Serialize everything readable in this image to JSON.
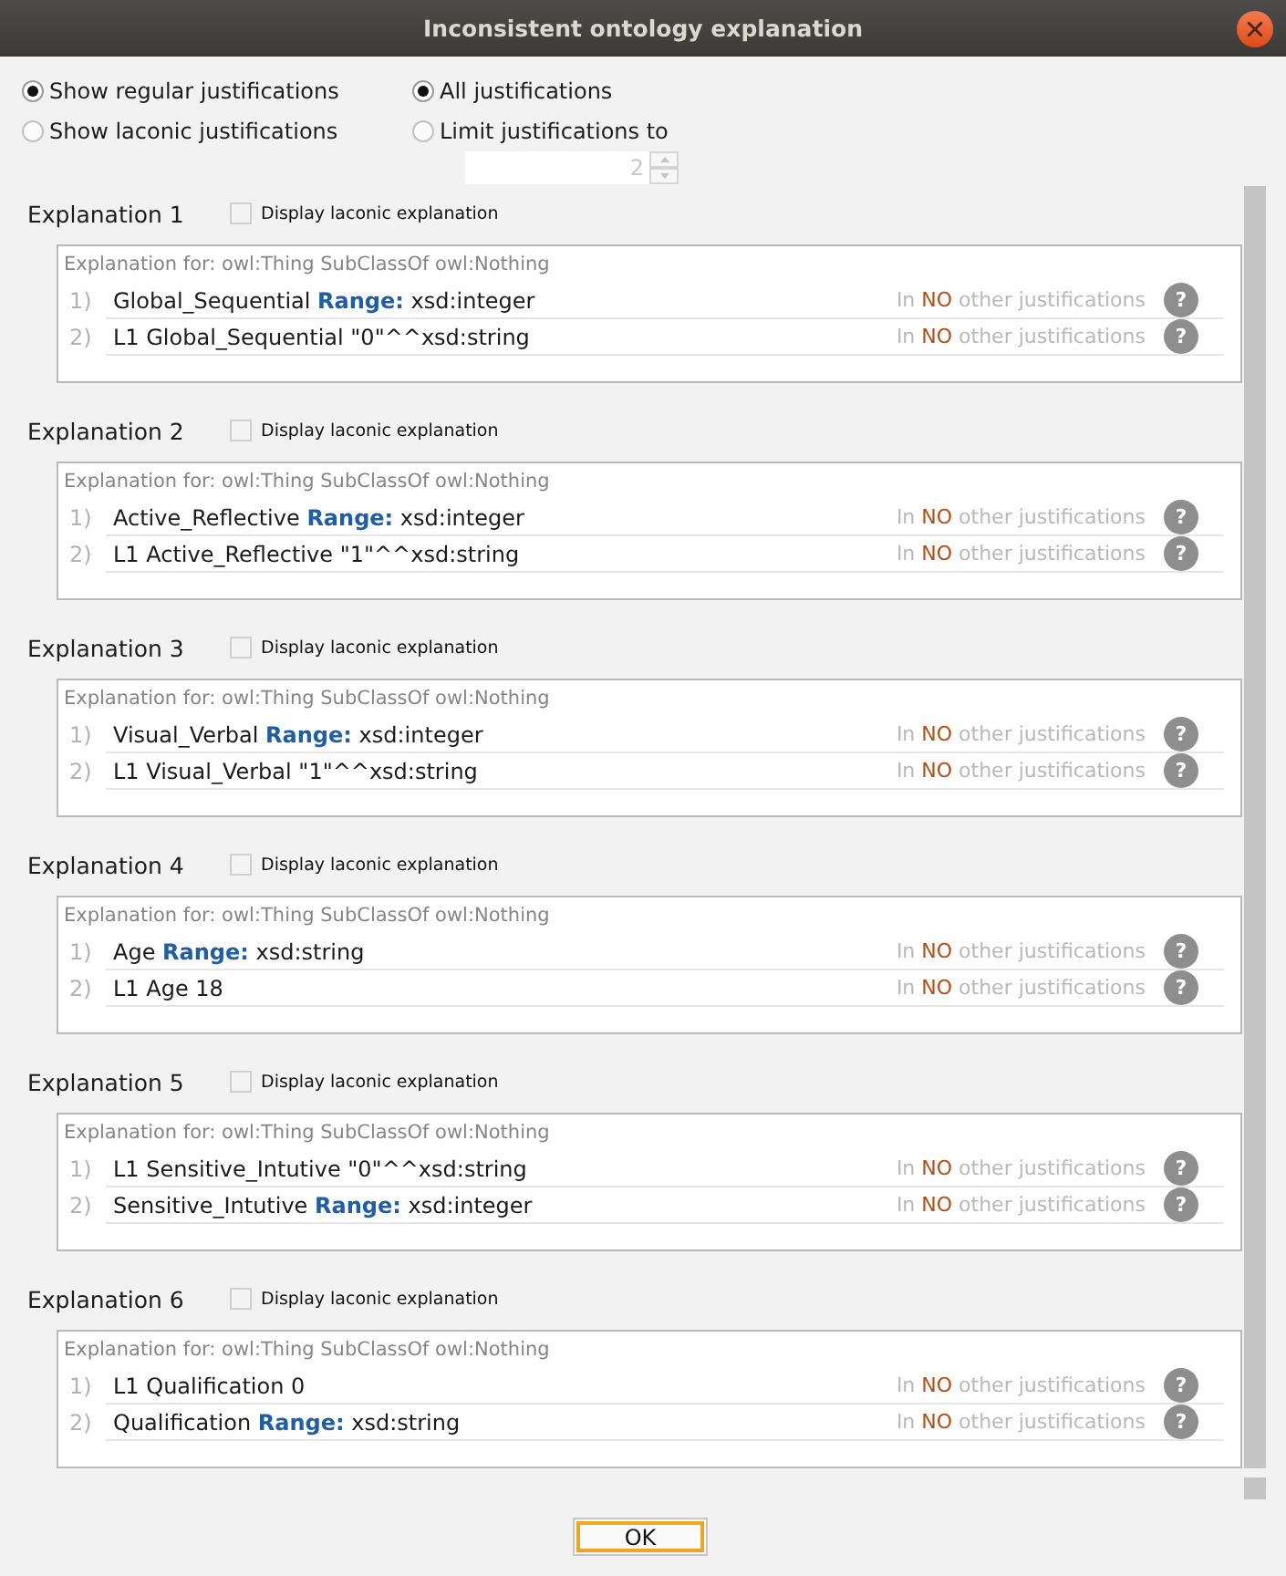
{
  "window": {
    "title": "Inconsistent ontology explanation"
  },
  "justification_kind": [
    {
      "label": "Show regular justifications",
      "selected": true
    },
    {
      "label": "Show laconic justifications",
      "selected": false
    }
  ],
  "justification_count": [
    {
      "label": "All justifications",
      "selected": true
    },
    {
      "label": "Limit justifications to",
      "selected": false
    }
  ],
  "limit_spinner": {
    "value": "2",
    "disabled": true
  },
  "explanations": [
    {
      "title": "Explanation 1",
      "laconic_checkbox": {
        "label": "Display laconic explanation",
        "checked": false
      },
      "explains": "Explanation for: owl:Thing SubClassOf owl:Nothing",
      "axioms": [
        {
          "number": "1)",
          "text": "Global_Sequential **Range:** xsd:integer",
          "usage": {
            "before": "In",
            "count": "NO",
            "after": "other justifications"
          },
          "help": "?"
        },
        {
          "number": "2)",
          "text": "L1 Global_Sequential \"0\"^^xsd:string",
          "usage": {
            "before": "In",
            "count": "NO",
            "after": "other justifications"
          },
          "help": "?"
        }
      ]
    },
    {
      "title": "Explanation 2",
      "laconic_checkbox": {
        "label": "Display laconic explanation",
        "checked": false
      },
      "explains": "Explanation for: owl:Thing SubClassOf owl:Nothing",
      "axioms": [
        {
          "number": "1)",
          "text": "Active_Reflective **Range:** xsd:integer",
          "usage": {
            "before": "In",
            "count": "NO",
            "after": "other justifications"
          },
          "help": "?"
        },
        {
          "number": "2)",
          "text": "L1 Active_Reflective \"1\"^^xsd:string",
          "usage": {
            "before": "In",
            "count": "NO",
            "after": "other justifications"
          },
          "help": "?"
        }
      ]
    },
    {
      "title": "Explanation 3",
      "laconic_checkbox": {
        "label": "Display laconic explanation",
        "checked": false
      },
      "explains": "Explanation for: owl:Thing SubClassOf owl:Nothing",
      "axioms": [
        {
          "number": "1)",
          "text": "Visual_Verbal **Range:** xsd:integer",
          "usage": {
            "before": "In",
            "count": "NO",
            "after": "other justifications"
          },
          "help": "?"
        },
        {
          "number": "2)",
          "text": "L1 Visual_Verbal \"1\"^^xsd:string",
          "usage": {
            "before": "In",
            "count": "NO",
            "after": "other justifications"
          },
          "help": "?"
        }
      ]
    },
    {
      "title": "Explanation 4",
      "laconic_checkbox": {
        "label": "Display laconic explanation",
        "checked": false
      },
      "explains": "Explanation for: owl:Thing SubClassOf owl:Nothing",
      "axioms": [
        {
          "number": "1)",
          "text": "Age **Range:** xsd:string",
          "usage": {
            "before": "In",
            "count": "NO",
            "after": "other justifications"
          },
          "help": "?"
        },
        {
          "number": "2)",
          "text": "L1 Age 18",
          "usage": {
            "before": "In",
            "count": "NO",
            "after": "other justifications"
          },
          "help": "?"
        }
      ]
    },
    {
      "title": "Explanation 5",
      "laconic_checkbox": {
        "label": "Display laconic explanation",
        "checked": false
      },
      "explains": "Explanation for: owl:Thing SubClassOf owl:Nothing",
      "axioms": [
        {
          "number": "1)",
          "text": "L1 Sensitive_Intutive \"0\"^^xsd:string",
          "usage": {
            "before": "In",
            "count": "NO",
            "after": "other justifications"
          },
          "help": "?"
        },
        {
          "number": "2)",
          "text": "Sensitive_Intutive **Range:** xsd:integer",
          "usage": {
            "before": "In",
            "count": "NO",
            "after": "other justifications"
          },
          "help": "?"
        }
      ]
    },
    {
      "title": "Explanation 6",
      "laconic_checkbox": {
        "label": "Display laconic explanation",
        "checked": false
      },
      "explains": "Explanation for: owl:Thing SubClassOf owl:Nothing",
      "axioms": [
        {
          "number": "1)",
          "text": "L1 Qualification 0",
          "usage": {
            "before": "In",
            "count": "NO",
            "after": "other justifications"
          },
          "help": "?"
        },
        {
          "number": "2)",
          "text": "Qualification **Range:** xsd:string",
          "usage": {
            "before": "In",
            "count": "NO",
            "after": "other justifications"
          },
          "help": "?"
        }
      ]
    }
  ],
  "buttons": [
    {
      "label": "OK",
      "focused": true
    }
  ]
}
